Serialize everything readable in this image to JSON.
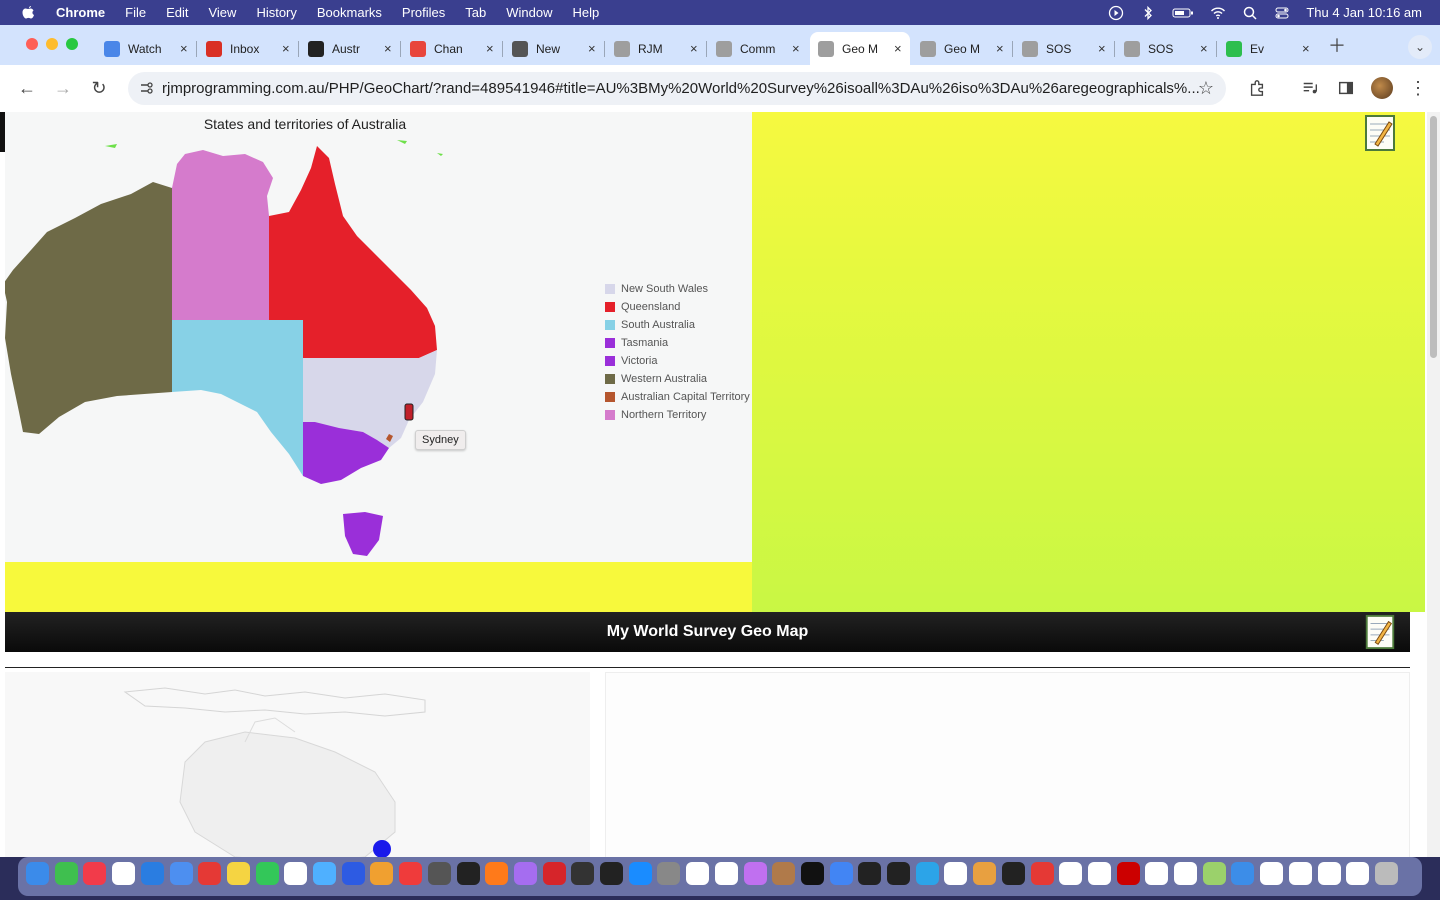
{
  "menubar": {
    "app_name": "Chrome",
    "items": [
      "File",
      "Edit",
      "View",
      "History",
      "Bookmarks",
      "Profiles",
      "Tab",
      "Window",
      "Help"
    ],
    "clock": "Thu 4 Jan  10:16 am"
  },
  "tabs": [
    {
      "label": "Watch",
      "favicon_color": "#4a86e8"
    },
    {
      "label": "Inbox",
      "favicon_color": "#d93025"
    },
    {
      "label": "Austr",
      "favicon_color": "#222222"
    },
    {
      "label": "Chan",
      "favicon_color": "#e8453c"
    },
    {
      "label": "New",
      "favicon_color": "#555555"
    },
    {
      "label": "RJM",
      "favicon_color": "#9e9e9e"
    },
    {
      "label": "Comm",
      "favicon_color": "#9e9e9e"
    },
    {
      "label": "Geo M",
      "favicon_color": "#9e9e9e",
      "active": true
    },
    {
      "label": "Geo M",
      "favicon_color": "#9e9e9e"
    },
    {
      "label": "SOS",
      "favicon_color": "#9e9e9e"
    },
    {
      "label": "SOS",
      "favicon_color": "#9e9e9e"
    },
    {
      "label": "Ev",
      "favicon_color": "#2dbe4e"
    }
  ],
  "toolbar": {
    "url": "rjmprogramming.com.au/PHP/GeoChart/?rand=489541946#title=AU%3BMy%20World%20Survey%26isoall%3DAu%26iso%3DAu%26aregeographicals%..."
  },
  "page": {
    "map_title": "States and territories of Australia",
    "tooltip": "Sydney",
    "legend": [
      {
        "label": "New South Wales",
        "color": "#d7d7ea"
      },
      {
        "label": "Queensland",
        "color": "#e5202a"
      },
      {
        "label": "South Australia",
        "color": "#87d1e6"
      },
      {
        "label": "Tasmania",
        "color": "#9a2fd9"
      },
      {
        "label": "Victoria",
        "color": "#9a2fd9"
      },
      {
        "label": "Western Australia",
        "color": "#6e6a47"
      },
      {
        "label": "Australian Capital Territory",
        "color": "#b5562e"
      },
      {
        "label": "Northern Territory",
        "color": "#d57bcc"
      }
    ],
    "survey_heading": "My World Survey Geo Map"
  },
  "dock": {
    "colors": [
      "#3b8bea",
      "#3fbf4f",
      "#f23b4a",
      "#ffffff",
      "#2a7de1",
      "#4d8ff0",
      "#e53935",
      "#f5d442",
      "#33c759",
      "#ffffff",
      "#4fb0ff",
      "#2d5be3",
      "#f0a030",
      "#ef3b3b",
      "#555555",
      "#222222",
      "#ff7a1a",
      "#a56df0",
      "#d6252a",
      "#333333",
      "#222222",
      "#1a8cff",
      "#888888",
      "#ffffff",
      "#ffffff",
      "#c070f0",
      "#b07a4a",
      "#111111",
      "#4285f4",
      "#222222",
      "#222222",
      "#2ca4e8",
      "#ffffff",
      "#e8a040",
      "#222222",
      "#e53935",
      "#ffffff",
      "#ffffff",
      "#cc0000",
      "#ffffff",
      "#ffffff",
      "#9bd16b",
      "#3c8de8",
      "#ffffff",
      "#ffffff",
      "#ffffff",
      "#ffffff",
      "#bbbbbb"
    ]
  }
}
